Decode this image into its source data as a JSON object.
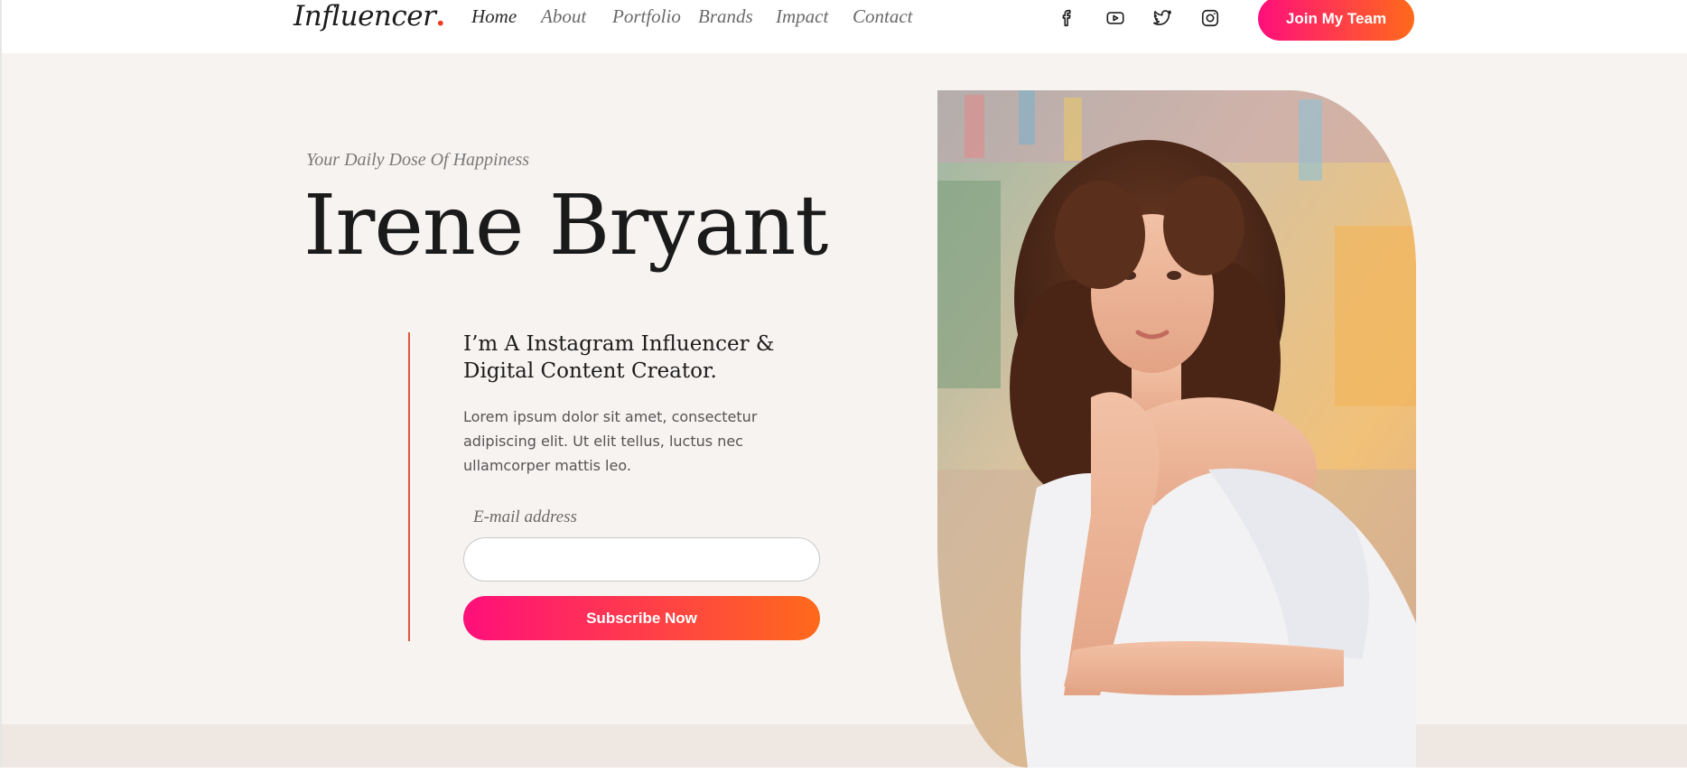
{
  "header": {
    "logo": "Influencer",
    "logo_dot": ".",
    "nav": [
      {
        "label": "Home",
        "active": true
      },
      {
        "label": "About"
      },
      {
        "label": "Portfolio"
      },
      {
        "label": "Brands"
      },
      {
        "label": "Impact"
      },
      {
        "label": "Contact"
      }
    ],
    "social_icons": [
      "facebook-icon",
      "youtube-icon",
      "twitter-icon",
      "instagram-icon"
    ],
    "cta_label": "Join My Team"
  },
  "hero": {
    "tagline": "Your Daily Dose Of Happiness",
    "name": "Irene Bryant",
    "subtitle": "I’m A Instagram Influencer & Digital Content Creator.",
    "description": "Lorem ipsum dolor sit amet, consectetur adipiscing elit. Ut elit tellus, luctus nec ullamcorper mattis leo.",
    "email_label": "E-mail address",
    "email_value": "",
    "subscribe_label": "Subscribe Now"
  },
  "colors": {
    "accent_gradient_start": "#ff0f7b",
    "accent_gradient_end": "#ff6a1a",
    "logo_dot": "#f23a1d",
    "divider": "#e0583a",
    "hero_background": "#f7f3f1"
  }
}
